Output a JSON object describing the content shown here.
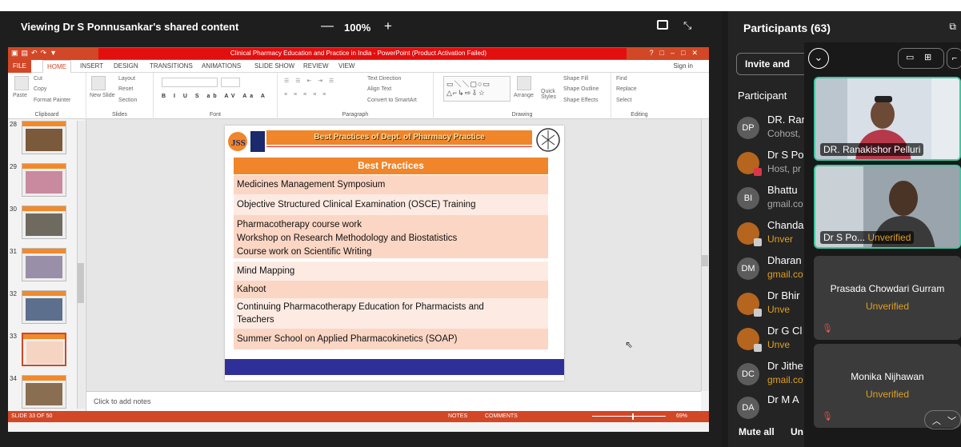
{
  "share": {
    "title": "Viewing Dr S Ponnusankar's shared content",
    "zoom_minus": "—",
    "zoom": "100%",
    "zoom_plus": "+"
  },
  "ppt": {
    "window_title": "Clinical Pharmacy Education and Practice in India - PowerPoint (Product Activation Failed)",
    "tabs": [
      "FILE",
      "HOME",
      "INSERT",
      "DESIGN",
      "TRANSITIONS",
      "ANIMATIONS",
      "SLIDE SHOW",
      "REVIEW",
      "VIEW"
    ],
    "sign_in": "Sign in",
    "ribbon": {
      "clipboard": {
        "label": "Clipboard",
        "paste": "Paste",
        "cut": "Cut",
        "copy": "Copy",
        "format_painter": "Format Painter"
      },
      "slides": {
        "label": "Slides",
        "new_slide": "New Slide",
        "layout": "Layout",
        "reset": "Reset",
        "section": "Section"
      },
      "font": {
        "label": "Font"
      },
      "paragraph": {
        "label": "Paragraph",
        "text_direction": "Text Direction",
        "align_text": "Align Text",
        "convert_smartart": "Convert to SmartArt"
      },
      "drawing": {
        "label": "Drawing",
        "arrange": "Arrange",
        "quick_styles": "Quick Styles",
        "shape_fill": "Shape Fill",
        "shape_outline": "Shape Outline",
        "shape_effects": "Shape Effects"
      },
      "editing": {
        "label": "Editing",
        "find": "Find",
        "replace": "Replace",
        "select": "Select"
      }
    },
    "thumbnails": [
      "28",
      "29",
      "30",
      "31",
      "32",
      "33",
      "34"
    ],
    "selected_slide": "33",
    "notes_placeholder": "Click to add notes",
    "status": {
      "slide": "SLIDE 33 OF 50",
      "notes": "NOTES",
      "comments": "COMMENTS",
      "zoom": "69%"
    }
  },
  "slide": {
    "banner": "Best Practices of Dept. of Pharmacy Practice",
    "logo_text": "JSS",
    "header": "Best Practices",
    "rows": [
      "Medicines Management Symposium",
      "Objective Structured Clinical Examination (OSCE) Training",
      "Pharmacotherapy course work",
      "Workshop on Research Methodology and Biostatistics",
      "Course work on Scientific Writing",
      "Mind Mapping",
      "Kahoot",
      "Continuing Pharmacotherapy Education for Pharmacists and",
      "Teachers",
      "Summer School on Applied Pharmacokinetics (SOAP)"
    ]
  },
  "participants": {
    "title": "Participants (63)",
    "invite": "Invite and",
    "section": "Participant",
    "list": [
      {
        "initials": "DP",
        "name": "DR. Ran",
        "sub": "Cohost,"
      },
      {
        "initials": "",
        "name": "Dr S Po",
        "sub": "Host, pr"
      },
      {
        "initials": "BI",
        "name": "Bhattu",
        "sub": "gmail.co"
      },
      {
        "initials": "",
        "name": "Chanda",
        "sub": "Unver"
      },
      {
        "initials": "DM",
        "name": "Dharan",
        "sub": "gmail.co"
      },
      {
        "initials": "",
        "name": "Dr Bhir",
        "sub": "Unve"
      },
      {
        "initials": "",
        "name": "Dr G Cl",
        "sub": "Unve"
      },
      {
        "initials": "DC",
        "name": "Dr Jithe",
        "sub": "gmail.co"
      },
      {
        "initials": "DA",
        "name": "Dr M A",
        "sub": ""
      }
    ],
    "mute_all": "Mute all",
    "unmute": "Un"
  },
  "videos": {
    "tile1_caption": "DR. Ranakishor Pelluri",
    "tile2_caption": "Dr S Po...",
    "tile2_unverified": "Unverified",
    "tile3_name": "Prasada Chowdari Gurram",
    "tile3_unverified": "Unverified",
    "tile4_name": "Monika Nijhawan",
    "tile4_unverified": "Unverified"
  },
  "colors": {
    "accent_green": "#3cc9a0",
    "ppt_red": "#d24726",
    "slide_orange": "#f0852a",
    "warning": "#e0a020"
  }
}
